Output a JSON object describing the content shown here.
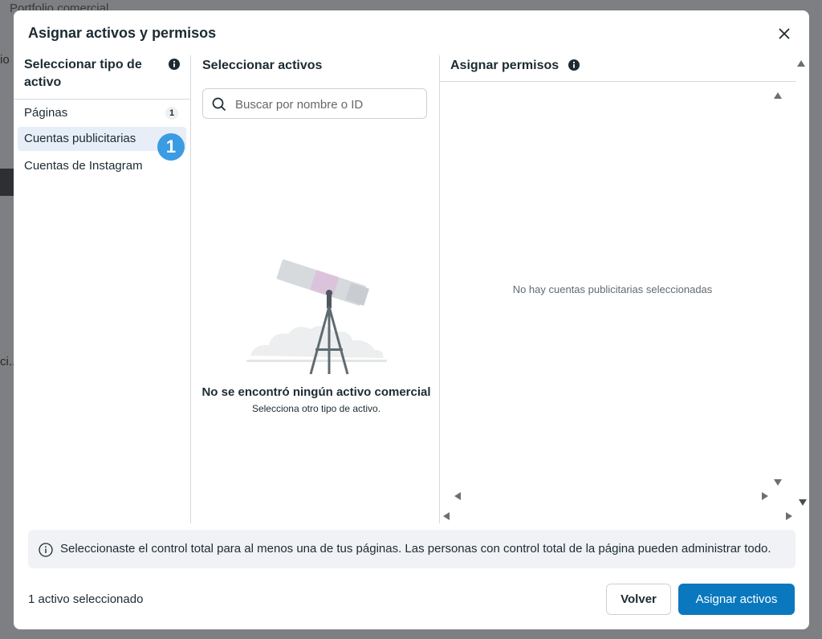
{
  "background": {
    "title": "Portfolio comercial",
    "fragment_top": "io",
    "fragment_mid": "ci..."
  },
  "modal": {
    "title": "Asignar activos y permisos",
    "close_icon": "close-icon"
  },
  "asset_types": {
    "header": "Seleccionar tipo de activo",
    "items": [
      {
        "label": "Páginas",
        "count": "1"
      },
      {
        "label": "Cuentas publicitarias",
        "step": "1"
      },
      {
        "label": "Cuentas de Instagram"
      }
    ]
  },
  "assets": {
    "header": "Seleccionar activos",
    "search_placeholder": "Buscar por nombre o ID",
    "search_value": "",
    "empty_title": "No se encontró ningún activo comercial",
    "empty_subtitle": "Selecciona otro tipo de activo."
  },
  "permissions": {
    "header": "Asignar permisos",
    "empty_text": "No hay cuentas publicitarias seleccionadas"
  },
  "notice": {
    "text": "Seleccionaste el control total para al menos una de tus páginas. Las personas con control total de la página pueden administrar todo."
  },
  "footer": {
    "selected_count": "1 activo seleccionado",
    "back_label": "Volver",
    "assign_label": "Asignar activos"
  },
  "colors": {
    "primary": "#0a78be",
    "step_badge": "#3b9be3",
    "selected_bg": "#e7eef7"
  }
}
